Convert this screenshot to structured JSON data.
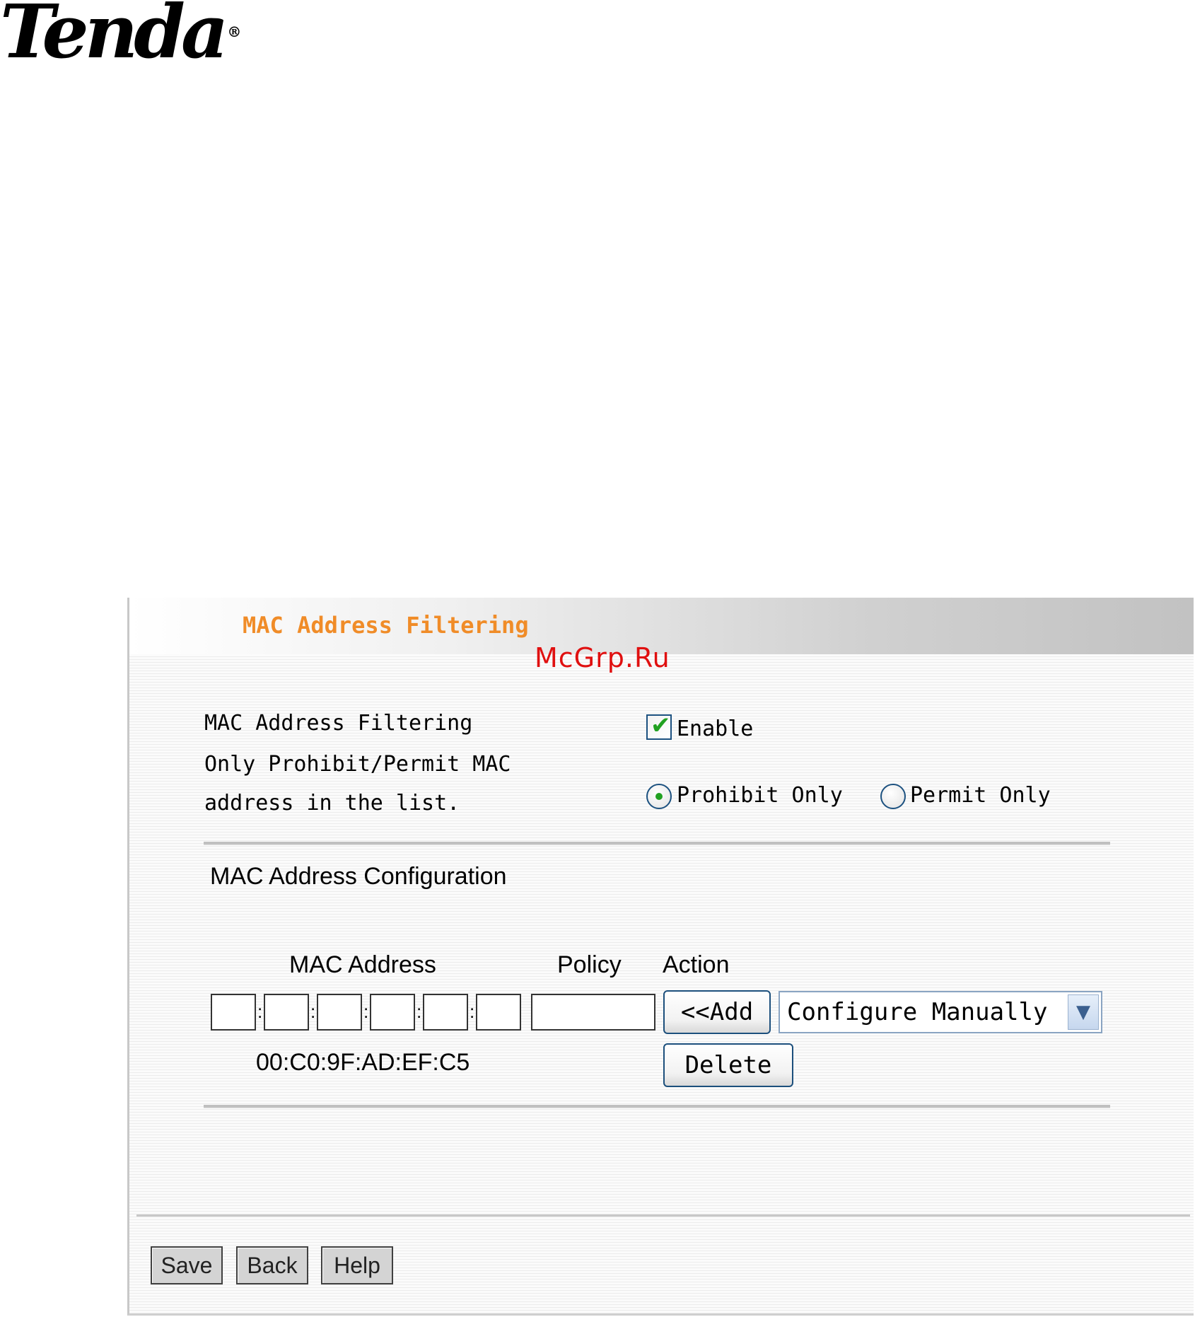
{
  "logo": {
    "text": "Tenda",
    "reg": "®"
  },
  "panel": {
    "title": "MAC Address Filtering",
    "watermark": "McGrp.Ru"
  },
  "filtering": {
    "label": "MAC Address Filtering",
    "enable_label": "Enable",
    "enabled": true
  },
  "policy_mode": {
    "label_line1": "Only Prohibit/Permit MAC",
    "label_line2": "address in the list.",
    "options": [
      "Prohibit Only",
      "Permit Only"
    ],
    "selected": "Prohibit Only"
  },
  "config": {
    "section_title": "MAC Address Configuration",
    "headers": {
      "mac": "MAC Address",
      "policy": "Policy",
      "action": "Action"
    },
    "mac_fields": [
      "",
      "",
      "",
      "",
      "",
      ""
    ],
    "policy_value": "",
    "add_label": "<<Add",
    "delete_label": "Delete",
    "select_value": "Configure Manually",
    "listed_mac": "00:C0:9F:AD:EF:C5"
  },
  "footer": {
    "save_label": "Save",
    "back_label": "Back",
    "help_label": "Help"
  },
  "colors": {
    "title": "#f08c28",
    "watermark": "#e01010",
    "check": "#21a121",
    "control_border": "#1c5180"
  }
}
